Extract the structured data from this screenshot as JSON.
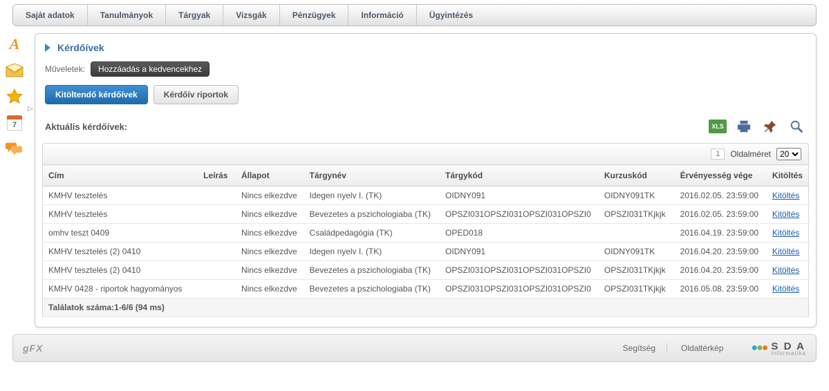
{
  "topmenu": [
    "Saját adatok",
    "Tanulmányok",
    "Tárgyak",
    "Vizsgák",
    "Pénzügyek",
    "Információ",
    "Ügyintézés"
  ],
  "sidebar": {
    "calendar_day": "7"
  },
  "page": {
    "title": "Kérdőívek",
    "ops_label": "Műveletek:",
    "add_fav": "Hozzáadás a kedvencekhez"
  },
  "tabs": {
    "active": "Kitöltendő kérdőívek",
    "other": "Kérdőív riportok"
  },
  "section": {
    "heading": "Aktuális kérdőívek:",
    "xls": "XLS"
  },
  "pager": {
    "page": "1",
    "size_label": "Oldalméret",
    "size_value": "20"
  },
  "columns": {
    "cim": "Cím",
    "leiras": "Leírás",
    "allapot": "Állapot",
    "targynev": "Tárgynév",
    "targykod": "Tárgykód",
    "kurzuskod": "Kurzuskód",
    "ervenyesseg": "Érvényesség vége",
    "kitoltes": "Kitöltés"
  },
  "rows": [
    {
      "cim": "KMHV tesztelés",
      "leiras": "",
      "allapot": "Nincs elkezdve",
      "targynev": "Idegen nyelv I. (TK)",
      "targykod": "OIDNY091",
      "kurzuskod": "OIDNY091TK",
      "erv": "2016.02.05. 23:59:00",
      "action": "Kitöltés"
    },
    {
      "cim": "KMHV tesztelés",
      "leiras": "",
      "allapot": "Nincs elkezdve",
      "targynev": "Bevezetes a pszichologiaba (TK)",
      "targykod": "OPSZI031OPSZI031OPSZI031OPSZI0",
      "kurzuskod": "OPSZI031TKjkjk",
      "erv": "2016.02.05. 23:59:00",
      "action": "Kitöltés"
    },
    {
      "cim": "omhv teszt 0409",
      "leiras": "",
      "allapot": "Nincs elkezdve",
      "targynev": "Családpedagógia (TK)",
      "targykod": "OPED018",
      "kurzuskod": "",
      "erv": "2016.04.19. 23:59:00",
      "action": "Kitöltés"
    },
    {
      "cim": "KMHV tesztelés (2) 0410",
      "leiras": "",
      "allapot": "Nincs elkezdve",
      "targynev": "Idegen nyelv I. (TK)",
      "targykod": "OIDNY091",
      "kurzuskod": "OIDNY091TK",
      "erv": "2016.04.20. 23:59:00",
      "action": "Kitöltés"
    },
    {
      "cim": "KMHV tesztelés (2) 0410",
      "leiras": "",
      "allapot": "Nincs elkezdve",
      "targynev": "Bevezetes a pszichologiaba (TK)",
      "targykod": "OPSZI031OPSZI031OPSZI031OPSZI0",
      "kurzuskod": "OPSZI031TKjkjk",
      "erv": "2016.04.20. 23:59:00",
      "action": "Kitöltés"
    },
    {
      "cim": "KMHV 0428 - riportok hagyományos",
      "leiras": "",
      "allapot": "Nincs elkezdve",
      "targynev": "Bevezetes a pszichologiaba (TK)",
      "targykod": "OPSZI031OPSZI031OPSZI031OPSZI0",
      "kurzuskod": "OPSZI031TKjkjk",
      "erv": "2016.05.08. 23:59:00",
      "action": "Kitöltés"
    }
  ],
  "results_summary": "Találatok száma:1-6/6 (94 ms)",
  "footer": {
    "gfx": "gFX",
    "help": "Segítség",
    "sitemap": "Oldaltérkép",
    "brand": "S D A",
    "brand_sub": "Informatika"
  }
}
